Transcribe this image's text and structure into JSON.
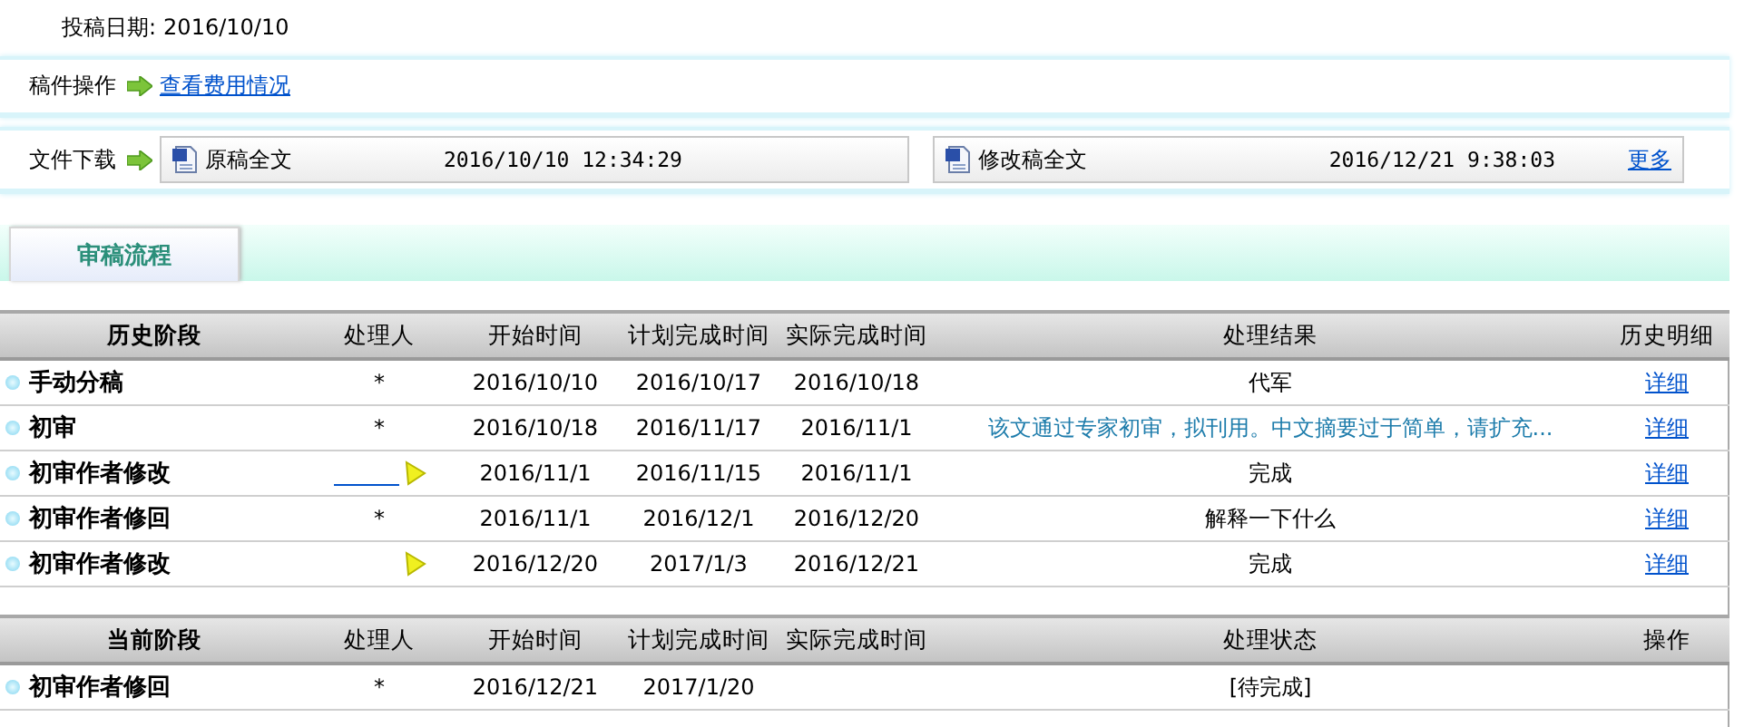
{
  "submission_date": {
    "label": "投稿日期:",
    "value": "2016/10/10"
  },
  "manuscript_actions": {
    "label": "稿件操作",
    "link": "查看费用情况"
  },
  "downloads": {
    "label": "文件下载",
    "files": [
      {
        "name": "原稿全文",
        "time": "2016/10/10 12:34:29"
      },
      {
        "name": "修改稿全文",
        "time": "2016/12/21 9:38:03",
        "more": "更多"
      }
    ]
  },
  "tabs": [
    {
      "label": "审稿流程",
      "selected": true
    }
  ],
  "history_table": {
    "columns": [
      "历史阶段",
      "处理人",
      "开始时间",
      "计划完成时间",
      "实际完成时间",
      "处理结果",
      "历史明细"
    ],
    "rows": [
      {
        "stage": "手动分稿",
        "handler": {
          "kind": "star",
          "text": "*"
        },
        "start": "2016/10/10",
        "planned": "2016/10/17",
        "actual": "2016/10/18",
        "result": {
          "kind": "plain",
          "text": "代军"
        },
        "detail": "详细"
      },
      {
        "stage": "初审",
        "handler": {
          "kind": "star",
          "text": "*"
        },
        "start": "2016/10/18",
        "planned": "2016/11/17",
        "actual": "2016/11/1",
        "result": {
          "kind": "note",
          "text": "该文通过专家初审，拟刊用。中文摘要过于简单，请扩充..."
        },
        "detail": "详细"
      },
      {
        "stage": "初审作者修改",
        "handler": {
          "kind": "blank-link-arrow"
        },
        "start": "2016/11/1",
        "planned": "2016/11/15",
        "actual": "2016/11/1",
        "result": {
          "kind": "plain",
          "text": "完成"
        },
        "detail": "详细"
      },
      {
        "stage": "初审作者修回",
        "handler": {
          "kind": "star",
          "text": "*"
        },
        "start": "2016/11/1",
        "planned": "2016/12/1",
        "actual": "2016/12/20",
        "result": {
          "kind": "plain",
          "text": "解释一下什么"
        },
        "detail": "详细"
      },
      {
        "stage": "初审作者修改",
        "handler": {
          "kind": "arrow"
        },
        "start": "2016/12/20",
        "planned": "2017/1/3",
        "actual": "2016/12/21",
        "result": {
          "kind": "plain",
          "text": "完成"
        },
        "detail": "详细"
      }
    ]
  },
  "current_table": {
    "columns": [
      "当前阶段",
      "处理人",
      "开始时间",
      "计划完成时间",
      "实际完成时间",
      "处理状态",
      "操作"
    ],
    "rows": [
      {
        "stage": "初审作者修回",
        "handler": {
          "kind": "star",
          "text": "*"
        },
        "start": "2016/12/21",
        "planned": "2017/1/20",
        "status": "[待完成]"
      }
    ]
  }
}
